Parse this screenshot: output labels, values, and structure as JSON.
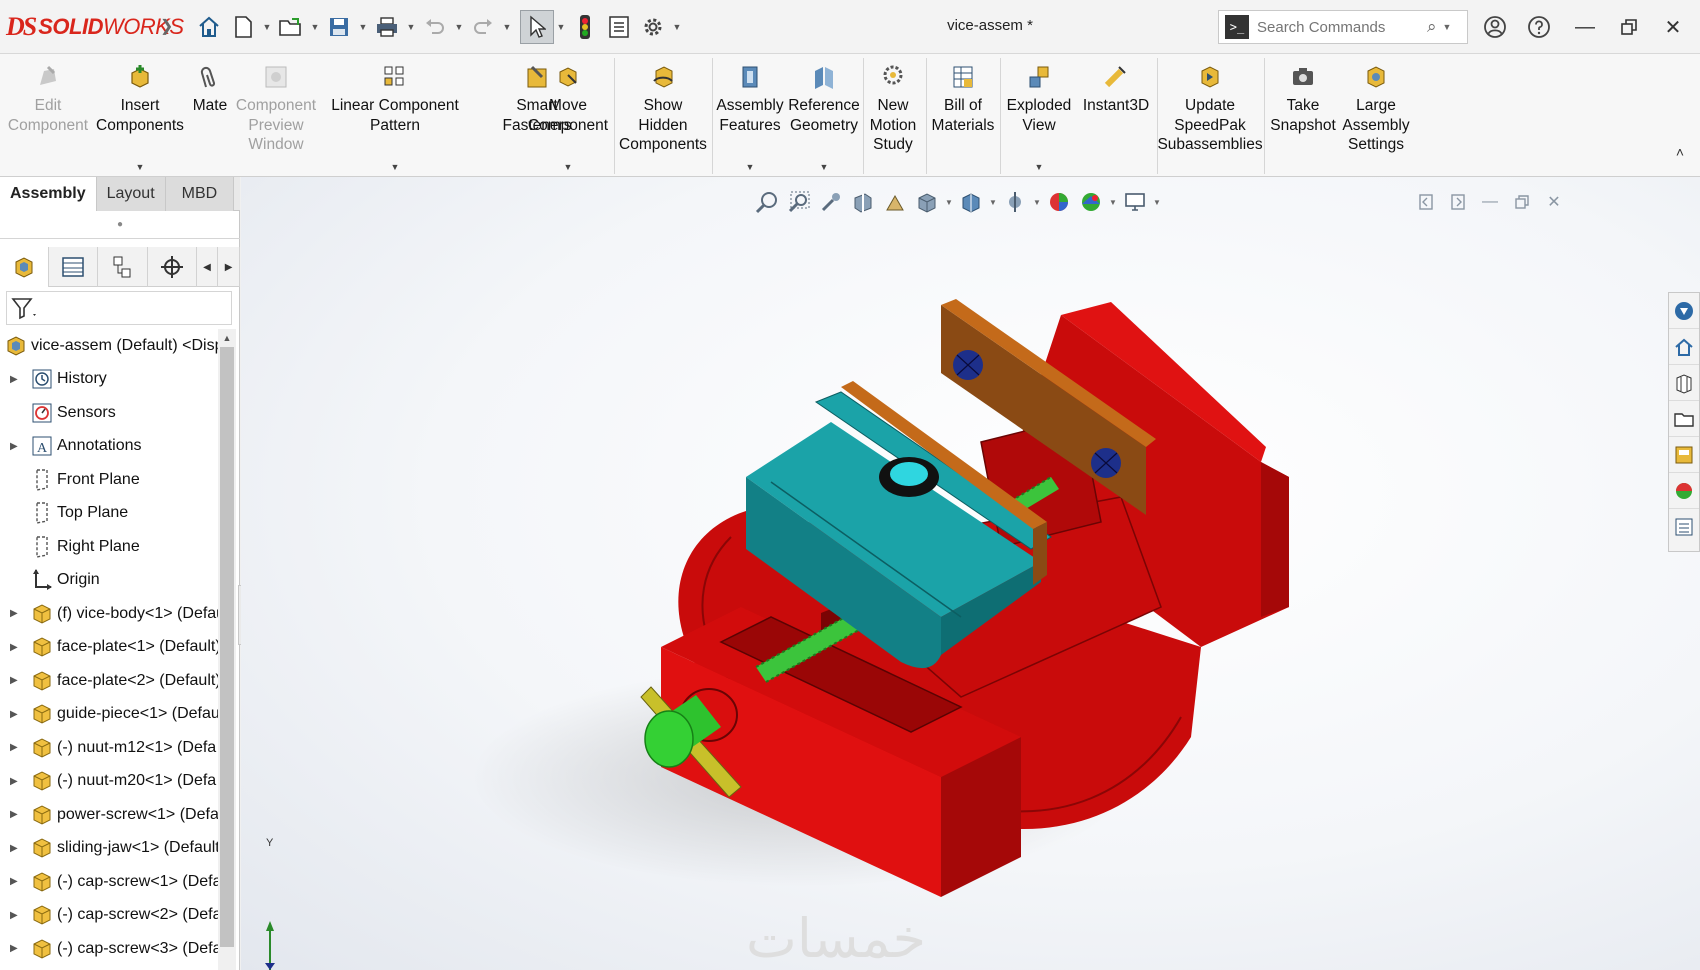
{
  "app": {
    "brand_mark": "DS",
    "brand_name_bold": "SOLID",
    "brand_name_light": "WORKS",
    "document_title": "vice-assem *"
  },
  "search": {
    "placeholder": "Search Commands"
  },
  "quick_access": [
    {
      "icon": "home-icon"
    },
    {
      "icon": "new-document-icon"
    },
    {
      "icon": "open-folder-icon"
    },
    {
      "icon": "save-icon"
    },
    {
      "icon": "print-icon"
    },
    {
      "icon": "undo-icon"
    },
    {
      "icon": "redo-icon"
    },
    {
      "icon": "select-arrow-icon"
    },
    {
      "icon": "rebuild-icon"
    },
    {
      "icon": "file-properties-icon"
    },
    {
      "icon": "options-gear-icon"
    }
  ],
  "ribbon": {
    "buttons": [
      {
        "label": "Edit\nComponent",
        "disabled": true
      },
      {
        "label": "Insert\nComponents",
        "disabled": false,
        "dropdown": true
      },
      {
        "label": "Mate",
        "disabled": false
      },
      {
        "label": "Component\nPreview\nWindow",
        "disabled": true
      },
      {
        "label": "Linear Component\nPattern",
        "disabled": false,
        "dropdown": true
      },
      {
        "label": "Smart\nFasteners",
        "disabled": false
      },
      {
        "label": "Move\nComponent",
        "disabled": false,
        "dropdown": true
      },
      {
        "label": "Show\nHidden\nComponents",
        "disabled": false
      },
      {
        "label": "Assembly\nFeatures",
        "disabled": false,
        "dropdown": true
      },
      {
        "label": "Reference\nGeometry",
        "disabled": false,
        "dropdown": true
      },
      {
        "label": "New\nMotion\nStudy",
        "disabled": false
      },
      {
        "label": "Bill of\nMaterials",
        "disabled": false
      },
      {
        "label": "Exploded\nView",
        "disabled": false,
        "dropdown": true
      },
      {
        "label": "Instant3D",
        "disabled": false
      },
      {
        "label": "Update\nSpeedPak\nSubassemblies",
        "disabled": false
      },
      {
        "label": "Take\nSnapshot",
        "disabled": false
      },
      {
        "label": "Large\nAssembly\nSettings",
        "disabled": false
      }
    ]
  },
  "tabs": [
    {
      "label": "Assembly",
      "active": true
    },
    {
      "label": "Layout",
      "active": false
    },
    {
      "label": "MBD",
      "active": false
    }
  ],
  "tree": [
    {
      "label": "vice-assem (Default) <Displ",
      "type": "assembly",
      "level": 0,
      "expandable": false
    },
    {
      "label": "History",
      "type": "history",
      "level": 1,
      "expandable": true
    },
    {
      "label": "Sensors",
      "type": "sensors",
      "level": 1,
      "expandable": false
    },
    {
      "label": "Annotations",
      "type": "annotations",
      "level": 1,
      "expandable": true
    },
    {
      "label": "Front Plane",
      "type": "plane",
      "level": 1,
      "expandable": false
    },
    {
      "label": "Top Plane",
      "type": "plane",
      "level": 1,
      "expandable": false
    },
    {
      "label": "Right Plane",
      "type": "plane",
      "level": 1,
      "expandable": false
    },
    {
      "label": "Origin",
      "type": "origin",
      "level": 1,
      "expandable": false
    },
    {
      "label": "(f) vice-body<1> (Defau",
      "type": "part",
      "level": 1,
      "expandable": true
    },
    {
      "label": "face-plate<1> (Default)",
      "type": "part",
      "level": 1,
      "expandable": true
    },
    {
      "label": "face-plate<2> (Default)",
      "type": "part",
      "level": 1,
      "expandable": true
    },
    {
      "label": "guide-piece<1> (Defau",
      "type": "part",
      "level": 1,
      "expandable": true
    },
    {
      "label": "(-) nuut-m12<1> (Defa",
      "type": "part",
      "level": 1,
      "expandable": true
    },
    {
      "label": "(-) nuut-m20<1> (Defa",
      "type": "part",
      "level": 1,
      "expandable": true
    },
    {
      "label": "power-screw<1> (Defa",
      "type": "part",
      "level": 1,
      "expandable": true
    },
    {
      "label": "sliding-jaw<1> (Default",
      "type": "part",
      "level": 1,
      "expandable": true
    },
    {
      "label": "(-) cap-screw<1> (Defa",
      "type": "part",
      "level": 1,
      "expandable": true
    },
    {
      "label": "(-) cap-screw<2> (Defa",
      "type": "part",
      "level": 1,
      "expandable": true
    },
    {
      "label": "(-) cap-screw<3> (Defa",
      "type": "part",
      "level": 1,
      "expandable": true
    }
  ],
  "triad": {
    "axis_label": "Y"
  },
  "watermark": "خمسات",
  "colors": {
    "vice_body": "#d50d0d",
    "sliding_jaw": "#19959b",
    "face_plate": "#b35a14",
    "power_screw": "#2ec22e",
    "handle_pin": "#c8c02a",
    "brand": "#d9261c"
  }
}
